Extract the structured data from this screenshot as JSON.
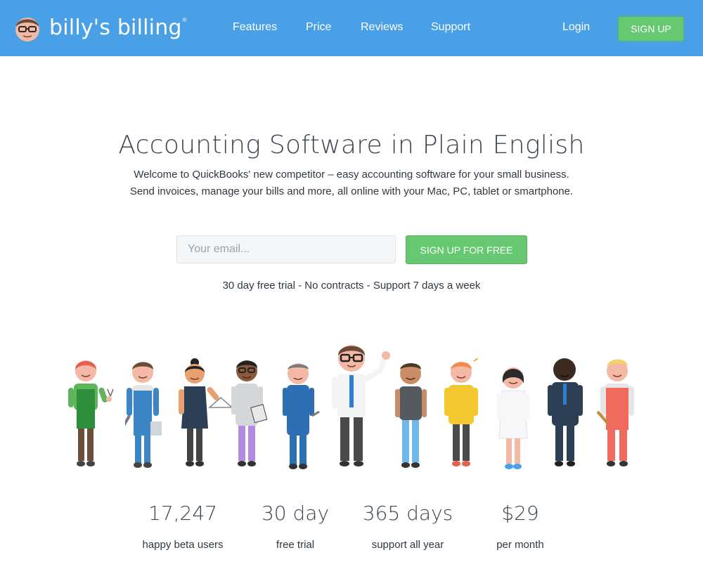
{
  "header": {
    "logo_text": "billy's billing",
    "logo_reg": "®",
    "nav": [
      "Features",
      "Price",
      "Reviews",
      "Support"
    ],
    "login": "Login",
    "signup": "SIGN UP"
  },
  "hero": {
    "title": "Accounting Software in Plain English",
    "subtitle_1": "Welcome to QuickBooks' new competitor – easy accounting software for your small business.",
    "subtitle_2": "Send invoices, manage your bills and more, all online with your Mac, PC, tablet or smartphone.",
    "email_placeholder": "Your email...",
    "cta": "SIGN UP FOR FREE",
    "note": "30 day free trial - No contracts - Support 7 days a week"
  },
  "stats": [
    {
      "value": "17,247",
      "label": "happy beta users"
    },
    {
      "value": "30 day",
      "label": "free trial"
    },
    {
      "value": "365 days",
      "label": "support all year"
    },
    {
      "value": "$29",
      "label": "per month"
    }
  ],
  "illustration": {
    "people": [
      "gardener",
      "painter",
      "tailor",
      "designer",
      "mechanic",
      "billy",
      "casual",
      "chef",
      "doctor",
      "businessman",
      "carpenter"
    ]
  },
  "colors": {
    "header_bg": "#4aa0e6",
    "accent_green": "#66c870",
    "text": "#3c4550"
  }
}
